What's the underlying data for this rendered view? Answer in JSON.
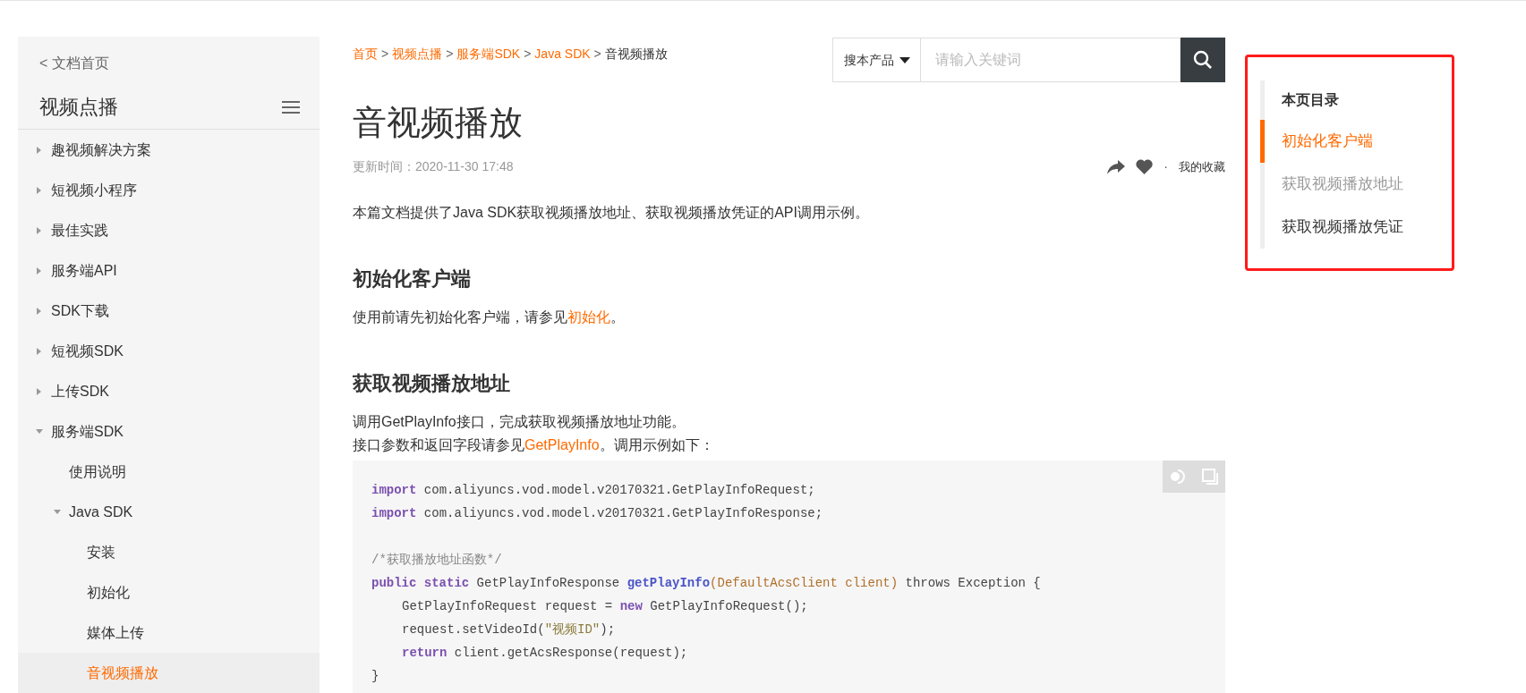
{
  "sidebar": {
    "back_link": "< 文档首页",
    "title": "视频点播",
    "items": [
      {
        "kind": "folder",
        "label": "趣视频解决方案",
        "expanded": false,
        "selected": false
      },
      {
        "kind": "folder",
        "label": "短视频小程序",
        "expanded": false,
        "selected": false
      },
      {
        "kind": "folder",
        "label": "最佳实践",
        "expanded": false,
        "selected": false
      },
      {
        "kind": "folder",
        "label": "服务端API",
        "expanded": false,
        "selected": false
      },
      {
        "kind": "folder",
        "label": "SDK下载",
        "expanded": false,
        "selected": false
      },
      {
        "kind": "folder",
        "label": "短视频SDK",
        "expanded": false,
        "selected": false
      },
      {
        "kind": "folder",
        "label": "上传SDK",
        "expanded": false,
        "selected": false
      },
      {
        "kind": "folder",
        "label": "服务端SDK",
        "expanded": true,
        "selected": false,
        "children": [
          {
            "kind": "page",
            "label": "使用说明",
            "selected": false
          },
          {
            "kind": "folder",
            "label": "Java SDK",
            "expanded": true,
            "selected": false,
            "children": [
              {
                "kind": "page",
                "label": "安装",
                "selected": false
              },
              {
                "kind": "page",
                "label": "初始化",
                "selected": false
              },
              {
                "kind": "page",
                "label": "媒体上传",
                "selected": false
              },
              {
                "kind": "page",
                "label": "音视频播放",
                "selected": true
              }
            ]
          }
        ]
      }
    ]
  },
  "breadcrumb": [
    {
      "kind": "link",
      "text": "首页"
    },
    {
      "kind": "separator",
      "text": ">"
    },
    {
      "kind": "link",
      "text": "视频点播"
    },
    {
      "kind": "separator",
      "text": ">"
    },
    {
      "kind": "link",
      "text": "服务端SDK"
    },
    {
      "kind": "separator",
      "text": ">"
    },
    {
      "kind": "link",
      "text": "Java SDK"
    },
    {
      "kind": "separator",
      "text": ">"
    },
    {
      "kind": "current",
      "text": "音视频播放"
    }
  ],
  "search": {
    "scope": "搜本产品",
    "placeholder": "请输入关键词"
  },
  "article": {
    "title": "音视频播放",
    "updated": "更新时间：2020-11-30 17:48",
    "favorites_dot": "·",
    "favorites": "我的收藏",
    "blocks": [
      {
        "kind": "paragraph",
        "parts": [
          {
            "text": "本篇文档提供了Java SDK获取视频播放地址、获取视频播放凭证的API调用示例。",
            "link": false
          }
        ]
      },
      {
        "kind": "heading",
        "text": "初始化客户端"
      },
      {
        "kind": "paragraph",
        "parts": [
          {
            "text": "使用前请先初始化客户端，请参见",
            "link": false
          },
          {
            "text": "初始化",
            "link": true
          },
          {
            "text": "。",
            "link": false
          }
        ]
      },
      {
        "kind": "heading",
        "text": "获取视频播放地址"
      },
      {
        "kind": "paragraph",
        "parts": [
          {
            "text": "调用GetPlayInfo接口，完成获取视频播放地址功能。",
            "link": false
          }
        ]
      },
      {
        "kind": "paragraph",
        "parts": [
          {
            "text": "接口参数和返回字段请参见",
            "link": false
          },
          {
            "text": "GetPlayInfo",
            "link": true
          },
          {
            "text": "。调用示例如下：",
            "link": false
          }
        ]
      },
      {
        "kind": "code",
        "lines": [
          {
            "kind": "code",
            "tokens": [
              {
                "kind": "keyword",
                "text": "import"
              },
              {
                "kind": "plain",
                "text": " com.aliyuncs.vod.model.v20170321.GetPlayInfoRequest;"
              }
            ]
          },
          {
            "kind": "code",
            "tokens": [
              {
                "kind": "keyword",
                "text": "import"
              },
              {
                "kind": "plain",
                "text": " com.aliyuncs.vod.model.v20170321.GetPlayInfoResponse;"
              }
            ]
          },
          {
            "kind": "blank"
          },
          {
            "kind": "code",
            "tokens": [
              {
                "kind": "comment",
                "text": "/*获取播放地址函数*/"
              }
            ]
          },
          {
            "kind": "code",
            "tokens": [
              {
                "kind": "keyword",
                "text": "public static"
              },
              {
                "kind": "plain",
                "text": " GetPlayInfoResponse "
              },
              {
                "kind": "function",
                "text": "getPlayInfo"
              },
              {
                "kind": "param",
                "text": "(DefaultAcsClient client)"
              },
              {
                "kind": "plain",
                "text": " throws Exception {"
              }
            ]
          },
          {
            "kind": "indented",
            "tokens": [
              {
                "kind": "plain",
                "text": "GetPlayInfoRequest request = "
              },
              {
                "kind": "keyword",
                "text": "new"
              },
              {
                "kind": "plain",
                "text": " GetPlayInfoRequest();"
              }
            ]
          },
          {
            "kind": "indented",
            "tokens": [
              {
                "kind": "plain",
                "text": "request.setVideoId("
              },
              {
                "kind": "string",
                "text": "\"视频ID\""
              },
              {
                "kind": "plain",
                "text": ");"
              }
            ]
          },
          {
            "kind": "indented",
            "tokens": [
              {
                "kind": "keyword",
                "text": "return"
              },
              {
                "kind": "plain",
                "text": " client.getAcsResponse(request);"
              }
            ]
          },
          {
            "kind": "code",
            "tokens": [
              {
                "kind": "plain",
                "text": "}"
              }
            ]
          }
        ]
      }
    ]
  },
  "toc": {
    "title": "本页目录",
    "items": [
      {
        "label": "初始化客户端",
        "selected": true,
        "muted": false
      },
      {
        "label": "获取视频播放地址",
        "selected": false,
        "muted": true
      },
      {
        "label": "获取视频播放凭证",
        "selected": false,
        "muted": false
      }
    ]
  }
}
